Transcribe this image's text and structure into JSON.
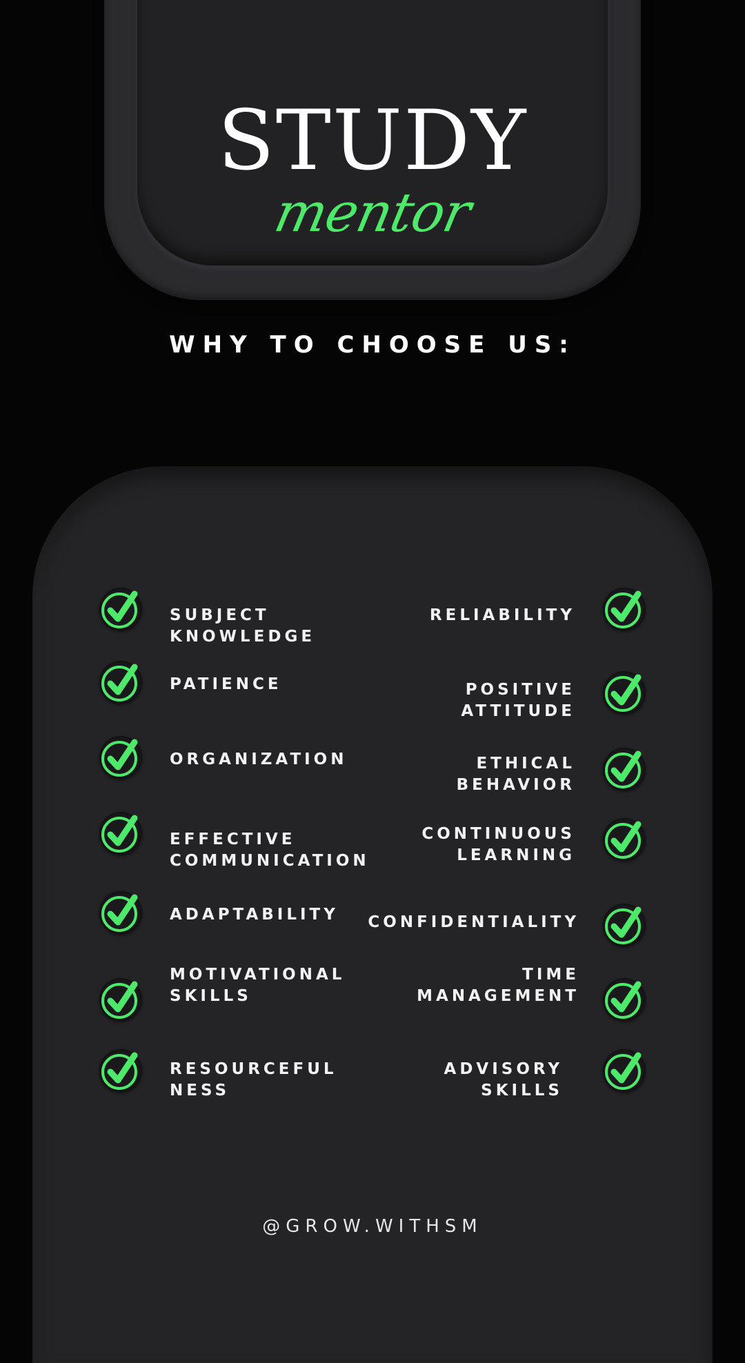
{
  "brand": {
    "title": "STUDY",
    "subtitle": "mentor"
  },
  "heading": "WHY TO CHOOSE US:",
  "accent_color": "#4ee86a",
  "icon": "check-circle-icon",
  "features": {
    "left": [
      "SUBJECT\nKNOWLEDGE",
      "PATIENCE",
      "ORGANIZATION",
      "EFFECTIVE\nCOMMUNICATION",
      "ADAPTABILITY",
      "MOTIVATIONAL\nSKILLS",
      "RESOURCEFUL\nNESS"
    ],
    "right": [
      "RELIABILITY",
      "POSITIVE\nATTITUDE",
      "ETHICAL\nBEHAVIOR",
      "CONTINUOUS\nLEARNING",
      "CONFIDENTIALITY",
      "TIME\nMANAGEMENT",
      "ADVISORY\nSKILLS"
    ]
  },
  "footer": "@GROW.WITHSM"
}
